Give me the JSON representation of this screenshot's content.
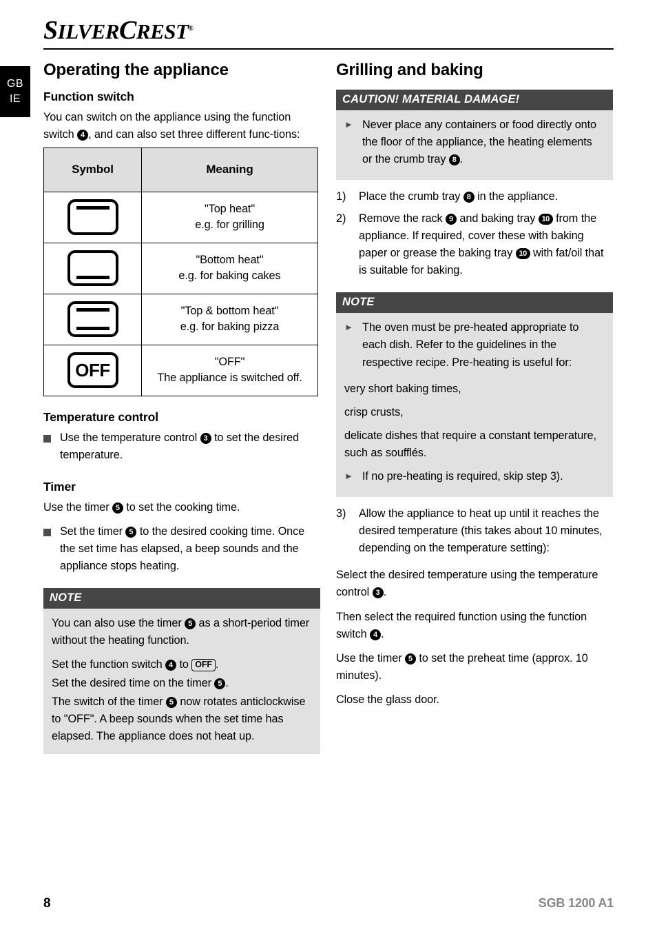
{
  "header": {
    "brand_first": "S",
    "brand_rest": "ILVER",
    "brand_second_first": "C",
    "brand_second_rest": "REST",
    "trademark": "®"
  },
  "language_tab": {
    "line1": "GB",
    "line2": "IE"
  },
  "left_column": {
    "title": "Operating the appliance",
    "function_switch": {
      "heading": "Function switch",
      "intro_a": "You can switch on the appliance using the function switch ",
      "callout_4": "4",
      "intro_b": ", and can also set three different func-tions:"
    },
    "symbol_table": {
      "headers": [
        "Symbol",
        "Meaning"
      ],
      "rows": [
        {
          "symbol": "oven-top-heat-icon",
          "bars": [
            "top"
          ],
          "meaning_line1": "\"Top heat\"",
          "meaning_line2": "e.g. for grilling"
        },
        {
          "symbol": "oven-bottom-heat-icon",
          "bars": [
            "bottom"
          ],
          "meaning_line1": "\"Bottom heat\"",
          "meaning_line2": "e.g. for baking  cakes"
        },
        {
          "symbol": "oven-top-bottom-heat-icon",
          "bars": [
            "top",
            "bottom"
          ],
          "meaning_line1": "\"Top & bottom heat\"",
          "meaning_line2": "e.g. for baking pizza"
        },
        {
          "symbol": "oven-off-icon",
          "label": "OFF",
          "meaning_line1": "\"OFF\"",
          "meaning_line2": "The appliance is switched off."
        }
      ]
    },
    "temperature_control": {
      "heading": "Temperature control",
      "bullet_a": "Use the temperature control ",
      "callout_3": "3",
      "bullet_b": " to set the desired temperature."
    },
    "timer": {
      "heading": "Timer",
      "intro_a": "Use the timer ",
      "callout_5": "5",
      "intro_b": " to set the cooking time.",
      "bullet_a": "Set the timer ",
      "bullet_callout_5": "5",
      "bullet_b": " to the desired cooking time. Once the set time has elapsed, a beep sounds and the appliance stops heating."
    },
    "note": {
      "header": "NOTE",
      "para1_a": "You can also use the timer ",
      "para1_callout_5": "5",
      "para1_b": " as a short-period timer without the heating function.",
      "sub1_a": "Set the function switch ",
      "sub1_callout_4": "4",
      "sub1_b": " to ",
      "sub1_offkey": "OFF",
      "sub1_c": ".",
      "sub2_a": "Set the desired time on the timer ",
      "sub2_callout_5": "5",
      "sub2_b": ".",
      "para2_a": "The switch of the timer ",
      "para2_callout_5": "5",
      "para2_b": " now rotates anticlockwise to \"OFF\". A beep sounds when the set time has elapsed. The appliance does not heat up."
    }
  },
  "right_column": {
    "title": "Grilling and baking",
    "caution": {
      "header": "CAUTION! MATERIAL DAMAGE!",
      "bullet_marker": "►",
      "bullet_a": "Never place any containers or food directly onto the floor of the appliance, the heating elements or the crumb tray ",
      "bullet_callout_8": "8",
      "bullet_b": "."
    },
    "steps_before_note": [
      {
        "number": "1)",
        "text_a": "Place the crumb tray ",
        "callout": "8",
        "text_b": " in the appliance."
      },
      {
        "number": "2)",
        "text_a": "Remove the rack ",
        "callout": "9",
        "text_b": " and baking tray ",
        "callout2": "10",
        "text_c": " from the appliance. If required, cover these with baking paper or grease the baking tray ",
        "callout3": "10",
        "text_d": " with fat/oil that is suitable for baking."
      }
    ],
    "note": {
      "header": "NOTE",
      "bullet_marker": "►",
      "bullet1": "The oven must be pre-heated appropriate to each dish. Refer to the guidelines in the respective recipe. Pre-heating is useful for:",
      "sub_items": [
        "very short baking times,",
        "crisp crusts,",
        "delicate dishes that require a constant temperature, such as soufflés."
      ],
      "bullet2": "If no pre-heating is required, skip step 3)."
    },
    "step3": {
      "number": "3)",
      "text": "Allow the appliance to heat up until it reaches the desired temperature (this takes about 10 minutes, depending on the temperature setting):",
      "sub_items": [
        {
          "text_a": "Select the desired temperature using the temperature control ",
          "callout": "3",
          "text_b": "."
        },
        {
          "text_a": "Then select the required function using the function switch ",
          "callout": "4",
          "text_b": "."
        },
        {
          "text_a": "Use the timer ",
          "callout": "5",
          "text_b": " to set the preheat time (approx. 10 minutes)."
        },
        {
          "text_a": "Close the glass door.",
          "callout": "",
          "text_b": ""
        }
      ]
    }
  },
  "footer": {
    "page_number": "8",
    "model": "SGB 1200 A1"
  },
  "colors": {
    "callout_header_bg": "#454545",
    "callout_body_bg": "#e1e1e1",
    "table_header_bg": "#dedede",
    "bullet_square": "#4d4d4d",
    "model_text": "#878787"
  }
}
